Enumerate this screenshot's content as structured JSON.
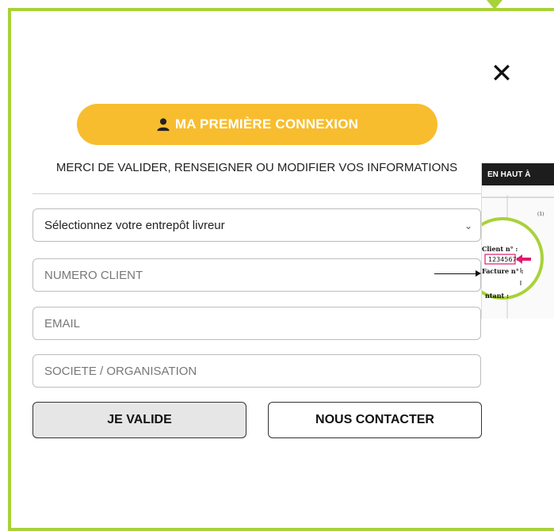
{
  "modal": {
    "close_icon": "close-icon",
    "banner_title": "MA PREMIÈRE CONNEXION",
    "banner_icon": "person-icon",
    "subtitle": "MERCI DE VALIDER, RENSEIGNER OU MODIFIER VOS INFORMATIONS"
  },
  "form": {
    "warehouse_select": "Sélectionnez votre entrepôt livreur",
    "client_number_placeholder": "NUMERO CLIENT",
    "email_placeholder": "EMAIL",
    "company_placeholder": "SOCIETE / ORGANISATION",
    "submit_label": "JE VALIDE",
    "contact_label": "NOUS CONTACTER"
  },
  "helper_image": {
    "header": "EN HAUT À",
    "client_label": "Client n° :",
    "client_example": "1234567",
    "invoice_label": "Facture n° :",
    "amount_label": "ntant :",
    "footnote": "(1)"
  },
  "colors": {
    "frame": "#a8d23a",
    "banner": "#f8bd2e",
    "highlight": "#e01a6f",
    "zoom_ring": "#a8d23a"
  }
}
